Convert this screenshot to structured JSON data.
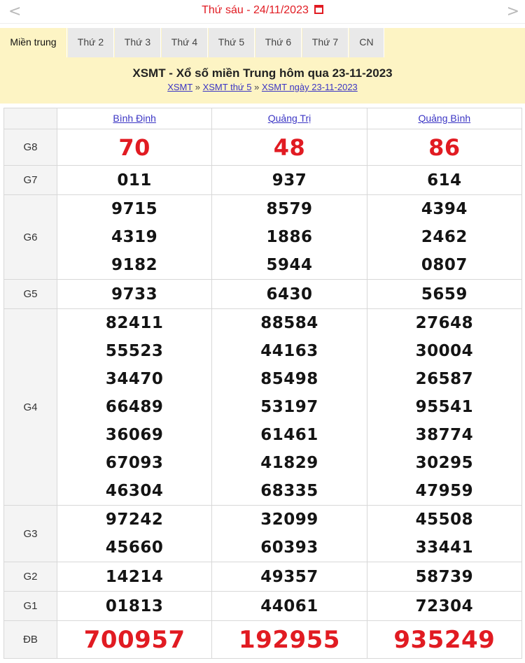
{
  "datebar": {
    "prev": "<",
    "next": ">",
    "date_text": "Thứ sáu -  24/11/2023"
  },
  "tabs": [
    "Miền trung",
    "Thứ 2",
    "Thứ 3",
    "Thứ 4",
    "Thứ 5",
    "Thứ 6",
    "Thứ 7",
    "CN"
  ],
  "header": {
    "title": "XSMT - Xổ số miền Trung hôm qua 23-11-2023",
    "crumb1": "XSMT",
    "sep": "»",
    "crumb2": "XSMT thứ 5",
    "crumb3": "XSMT ngày 23-11-2023"
  },
  "provinces": [
    "Bình Định",
    "Quảng Trị",
    "Quảng Bình"
  ],
  "prizes": [
    {
      "label": "G8",
      "numbers": [
        [
          "70"
        ],
        [
          "48"
        ],
        [
          "86"
        ]
      ]
    },
    {
      "label": "G7",
      "numbers": [
        [
          "011"
        ],
        [
          "937"
        ],
        [
          "614"
        ]
      ]
    },
    {
      "label": "G6",
      "numbers": [
        [
          "9715",
          "4319",
          "9182"
        ],
        [
          "8579",
          "1886",
          "5944"
        ],
        [
          "4394",
          "2462",
          "0807"
        ]
      ]
    },
    {
      "label": "G5",
      "numbers": [
        [
          "9733"
        ],
        [
          "6430"
        ],
        [
          "5659"
        ]
      ]
    },
    {
      "label": "G4",
      "numbers": [
        [
          "82411",
          "55523",
          "34470",
          "66489",
          "36069",
          "67093",
          "46304"
        ],
        [
          "88584",
          "44163",
          "85498",
          "53197",
          "61461",
          "41829",
          "68335"
        ],
        [
          "27648",
          "30004",
          "26587",
          "95541",
          "38774",
          "30295",
          "47959"
        ]
      ]
    },
    {
      "label": "G3",
      "numbers": [
        [
          "97242",
          "45660"
        ],
        [
          "32099",
          "60393"
        ],
        [
          "45508",
          "33441"
        ]
      ]
    },
    {
      "label": "G2",
      "numbers": [
        [
          "14214"
        ],
        [
          "49357"
        ],
        [
          "58739"
        ]
      ]
    },
    {
      "label": "G1",
      "numbers": [
        [
          "01813"
        ],
        [
          "44061"
        ],
        [
          "72304"
        ]
      ]
    },
    {
      "label": "ĐB",
      "numbers": [
        [
          "700957"
        ],
        [
          "192955"
        ],
        [
          "935249"
        ]
      ]
    }
  ],
  "colors": {
    "accent_red": "#e11b22",
    "link_blue": "#3b35c4",
    "header_bg": "#fdf4c4"
  }
}
